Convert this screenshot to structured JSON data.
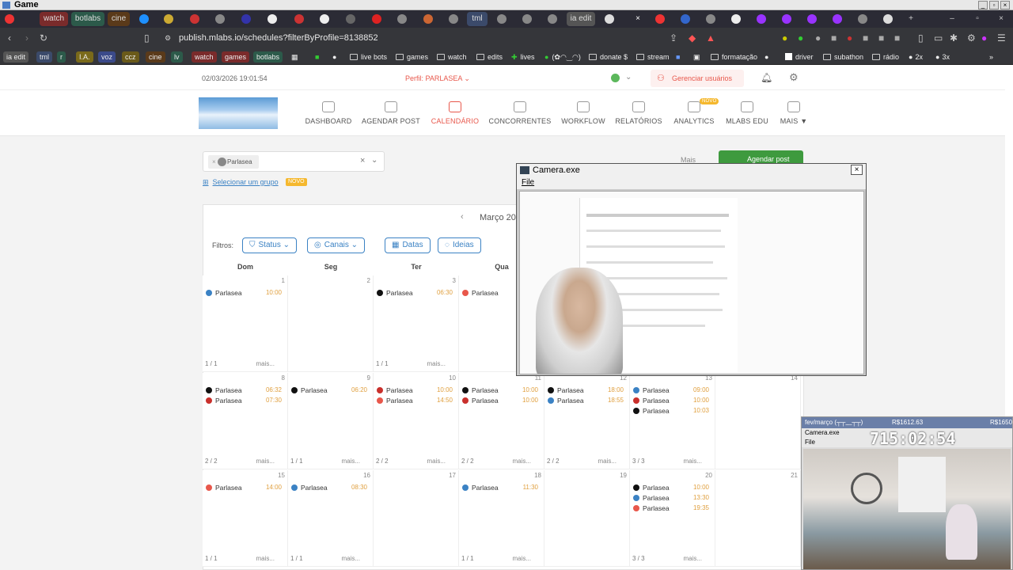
{
  "window": {
    "title": "Game"
  },
  "tabs": [
    "watch",
    "botlabs",
    "cine",
    "tml",
    "ia edit"
  ],
  "address": {
    "url": "publish.mlabs.io/schedules?filterByProfile=8138852"
  },
  "bookmarks": [
    "ia edit",
    "tml",
    "r",
    "I.A.",
    "voz",
    "ccz",
    "cine",
    "lv",
    "watch",
    "games",
    "botlabs",
    "live bots",
    "games",
    "watch",
    "edits",
    "lives",
    "(✿◠‿◠)",
    "donate $",
    "stream",
    "formatação",
    "driver",
    "subathon",
    "rádio",
    "2x",
    "3x"
  ],
  "header": {
    "datetime": "02/03/2026 19:01:54",
    "profile_label": "Perfil: PARLASEA",
    "manage_users": "Gerenciar usuários"
  },
  "nav": [
    {
      "label": "DASHBOARD",
      "icon": "dashboard-icon"
    },
    {
      "label": "AGENDAR POST",
      "icon": "calendar-add-icon"
    },
    {
      "label": "CALENDÁRIO",
      "icon": "calendar-icon"
    },
    {
      "label": "CONCORRENTES",
      "icon": "user-icon"
    },
    {
      "label": "WORKFLOW",
      "icon": "workflow-icon"
    },
    {
      "label": "RELATÓRIOS",
      "icon": "chart-line-icon"
    },
    {
      "label": "ANALYTICS",
      "icon": "analytics-icon",
      "badge": "NOVO"
    },
    {
      "label": "MLABS EDU",
      "icon": "graduation-icon"
    },
    {
      "label": "MAIS ▼",
      "icon": "grid-icon"
    }
  ],
  "toolbar": {
    "profile_chip": "Parlasea",
    "select_group": "Selecionar um grupo",
    "group_badge": "NOVO",
    "more": "Mais",
    "schedule_post": "Agendar post",
    "month": "Março 20",
    "filters_label": "Filtros:",
    "filters": [
      "Status",
      "Canais",
      "Datas",
      "Ideias"
    ]
  },
  "calendar": {
    "days": [
      "Dom",
      "Seg",
      "Ter",
      "Qua"
    ],
    "weeks": [
      [
        {
          "day": "1",
          "posts": [
            {
              "name": "Parlasea",
              "time": "10:00",
              "c": "#3b82c4"
            }
          ],
          "count": "1 / 1"
        },
        {
          "day": "2",
          "posts": [],
          "count": ""
        },
        {
          "day": "3",
          "posts": [
            {
              "name": "Parlasea",
              "time": "06:30",
              "c": "#111"
            }
          ],
          "count": "1 / 1"
        },
        {
          "day": "",
          "posts": [
            {
              "name": "Parlasea",
              "time": "",
              "c": "#e8574b"
            }
          ],
          "count": ""
        }
      ],
      [
        {
          "day": "8",
          "posts": [
            {
              "name": "Parlasea",
              "time": "06:32",
              "c": "#111"
            },
            {
              "name": "Parlasea",
              "time": "07:30",
              "c": "#c9302c"
            }
          ],
          "count": "2 / 2"
        },
        {
          "day": "9",
          "posts": [
            {
              "name": "Parlasea",
              "time": "06:20",
              "c": "#111"
            }
          ],
          "count": "1 / 1"
        },
        {
          "day": "10",
          "posts": [
            {
              "name": "Parlasea",
              "time": "10:00",
              "c": "#c9302c"
            },
            {
              "name": "Parlasea",
              "time": "14:50",
              "c": "#e8574b"
            }
          ],
          "count": "2 / 2"
        },
        {
          "day": "11",
          "posts": [
            {
              "name": "Parlasea",
              "time": "10:00",
              "c": "#111"
            },
            {
              "name": "Parlasea",
              "time": "10:00",
              "c": "#c9302c"
            }
          ],
          "count": "2 / 2"
        },
        {
          "day": "12",
          "posts": [
            {
              "name": "Parlasea",
              "time": "18:00",
              "c": "#111"
            },
            {
              "name": "Parlasea",
              "time": "18:55",
              "c": "#3b82c4"
            }
          ],
          "count": "2 / 2"
        },
        {
          "day": "13",
          "posts": [
            {
              "name": "Parlasea",
              "time": "09:00",
              "c": "#3b82c4"
            },
            {
              "name": "Parlasea",
              "time": "10:00",
              "c": "#c9302c"
            },
            {
              "name": "Parlasea",
              "time": "10:03",
              "c": "#111"
            }
          ],
          "count": "3 / 3"
        },
        {
          "day": "14",
          "posts": [],
          "count": ""
        }
      ],
      [
        {
          "day": "15",
          "posts": [
            {
              "name": "Parlasea",
              "time": "14:00",
              "c": "#e8574b"
            }
          ],
          "count": "1 / 1"
        },
        {
          "day": "16",
          "posts": [
            {
              "name": "Parlasea",
              "time": "08:30",
              "c": "#3b82c4"
            }
          ],
          "count": "1 / 1"
        },
        {
          "day": "17",
          "posts": [],
          "count": ""
        },
        {
          "day": "18",
          "posts": [
            {
              "name": "Parlasea",
              "time": "11:30",
              "c": "#3b82c4"
            }
          ],
          "count": "1 / 1"
        },
        {
          "day": "19",
          "posts": [],
          "count": ""
        },
        {
          "day": "20",
          "posts": [
            {
              "name": "Parlasea",
              "time": "10:00",
              "c": "#111"
            },
            {
              "name": "Parlasea",
              "time": "13:30",
              "c": "#3b82c4"
            },
            {
              "name": "Parlasea",
              "time": "19:35",
              "c": "#e8574b"
            }
          ],
          "count": "3 / 3"
        },
        {
          "day": "21",
          "posts": [],
          "count": ""
        }
      ]
    ],
    "more_label": "mais..."
  },
  "camera": {
    "title": "Camera.exe",
    "menu": "File"
  },
  "side": {
    "bar": "fev/março (┬┬﹏┬┬)",
    "money1": "R$1612.63",
    "money2": "R$1650",
    "subtitle": "Camera.exe",
    "sub2": "File",
    "timer": "715:02:54"
  }
}
